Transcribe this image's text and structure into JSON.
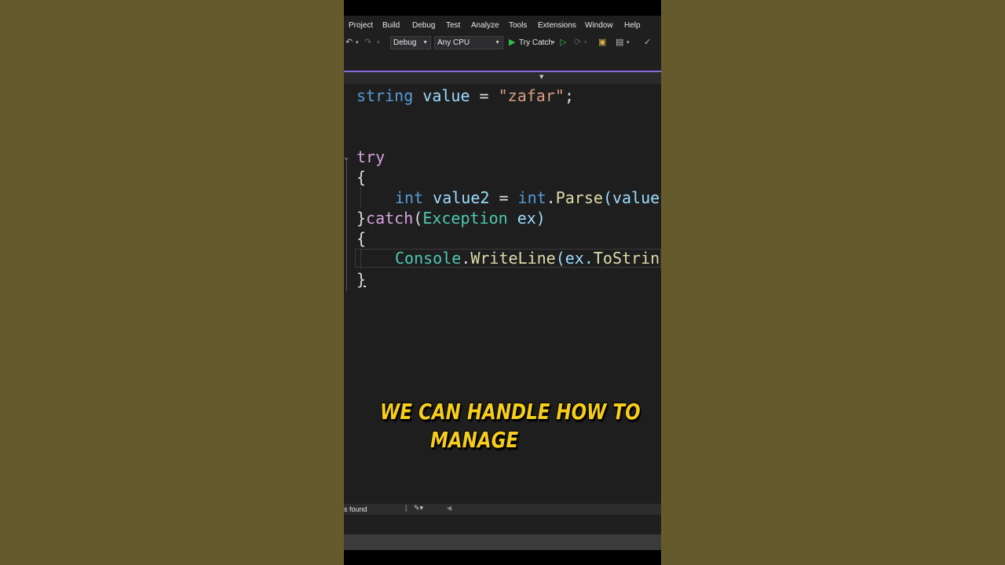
{
  "menu": [
    "Project",
    "Build",
    "Debug",
    "Test",
    "Analyze",
    "Tools",
    "Extensions",
    "Window",
    "Help"
  ],
  "toolbar": {
    "config": "Debug",
    "platform": "Any CPU",
    "run_label": "Try Catch"
  },
  "code": {
    "line1": {
      "kw": "string",
      "id": "value",
      "op": " = ",
      "str": "\"zafar\"",
      "end": ";"
    },
    "try_kw": "try",
    "open1": "{",
    "line3": {
      "kw": "int",
      "id": "value2",
      "op": " = ",
      "kw2": "int",
      "dot": ".",
      "fn": "Parse",
      "rest": "(value"
    },
    "catch_close": "}",
    "catch_kw": "catch",
    "catch_paren": "(",
    "catch_type": "Exception",
    "catch_var": " ex)",
    "open2": "{",
    "line6": {
      "type": "Console",
      "dot": ".",
      "fn": "WriteLine",
      "rest": "(ex.",
      "fn2": "ToStrin"
    },
    "close2": "}"
  },
  "status": {
    "found": "s found"
  },
  "caption": {
    "line1": "WE CAN HANDLE HOW TO",
    "line2": "MANAGE"
  },
  "colors": {
    "accent": "#8a6ae0",
    "caption": "#f5cd1d",
    "background": "#655a2c"
  }
}
